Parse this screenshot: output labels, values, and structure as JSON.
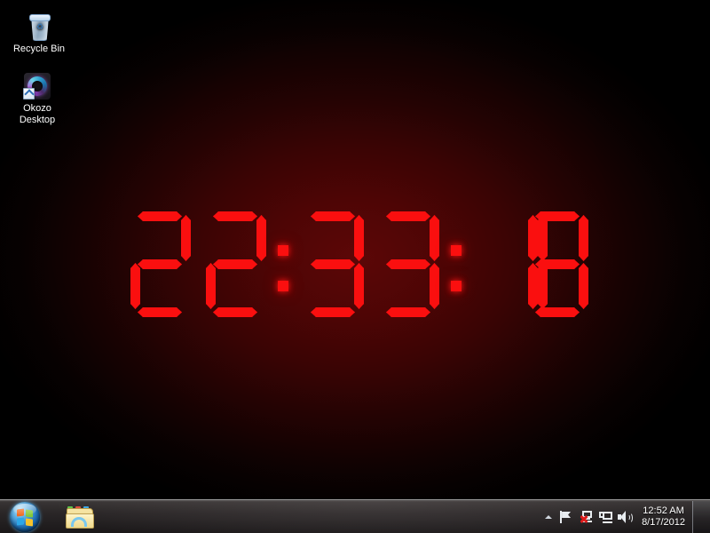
{
  "desktop": {
    "icons": [
      {
        "name": "recycle-bin",
        "label": "Recycle Bin"
      },
      {
        "name": "okozo-desktop",
        "label": "Okozo\nDesktop",
        "label_line1": "Okozo",
        "label_line2": "Desktop"
      }
    ],
    "wallpaper": {
      "description": "dark red radial glow background",
      "center_color": "#5c0707",
      "edge_color": "#000000"
    }
  },
  "clock_widget": {
    "name": "okozo-led-clock",
    "time_text": "22:33:18",
    "hours": "22",
    "minutes": "33",
    "seconds": "18",
    "separator": ":",
    "digit_color": "#fa0f0f",
    "glow_color": "#e60000",
    "style": "seven-segment",
    "digits": [
      {
        "char": "2",
        "segments": [
          "a",
          "b",
          "g",
          "e",
          "d"
        ]
      },
      {
        "char": "2",
        "segments": [
          "a",
          "b",
          "g",
          "e",
          "d"
        ]
      },
      {
        "char": "3",
        "segments": [
          "a",
          "b",
          "g",
          "c",
          "d"
        ]
      },
      {
        "char": "3",
        "segments": [
          "a",
          "b",
          "g",
          "c",
          "d"
        ]
      },
      {
        "char": "1",
        "segments": [
          "b",
          "c"
        ]
      },
      {
        "char": "8",
        "segments": [
          "a",
          "b",
          "c",
          "d",
          "e",
          "f",
          "g"
        ]
      }
    ]
  },
  "taskbar": {
    "start_button": {
      "name": "start-orb",
      "tooltip": "Start"
    },
    "pinned": [
      {
        "name": "windows-explorer",
        "label": "Windows Explorer"
      }
    ],
    "tray": {
      "show_hidden_icons": {
        "name": "show-hidden-icons-arrow",
        "label": "Show hidden icons"
      },
      "icons": [
        {
          "name": "action-center-flag-icon",
          "label": "Action Center"
        },
        {
          "name": "network-error-icon",
          "label": "Network - no connection"
        },
        {
          "name": "network-icon",
          "label": "Network"
        },
        {
          "name": "volume-icon",
          "label": "Volume"
        }
      ],
      "clock": {
        "time": "12:52 AM",
        "date": "8/17/2012"
      }
    },
    "show_desktop_button": {
      "name": "show-desktop-button",
      "label": "Show desktop"
    }
  }
}
